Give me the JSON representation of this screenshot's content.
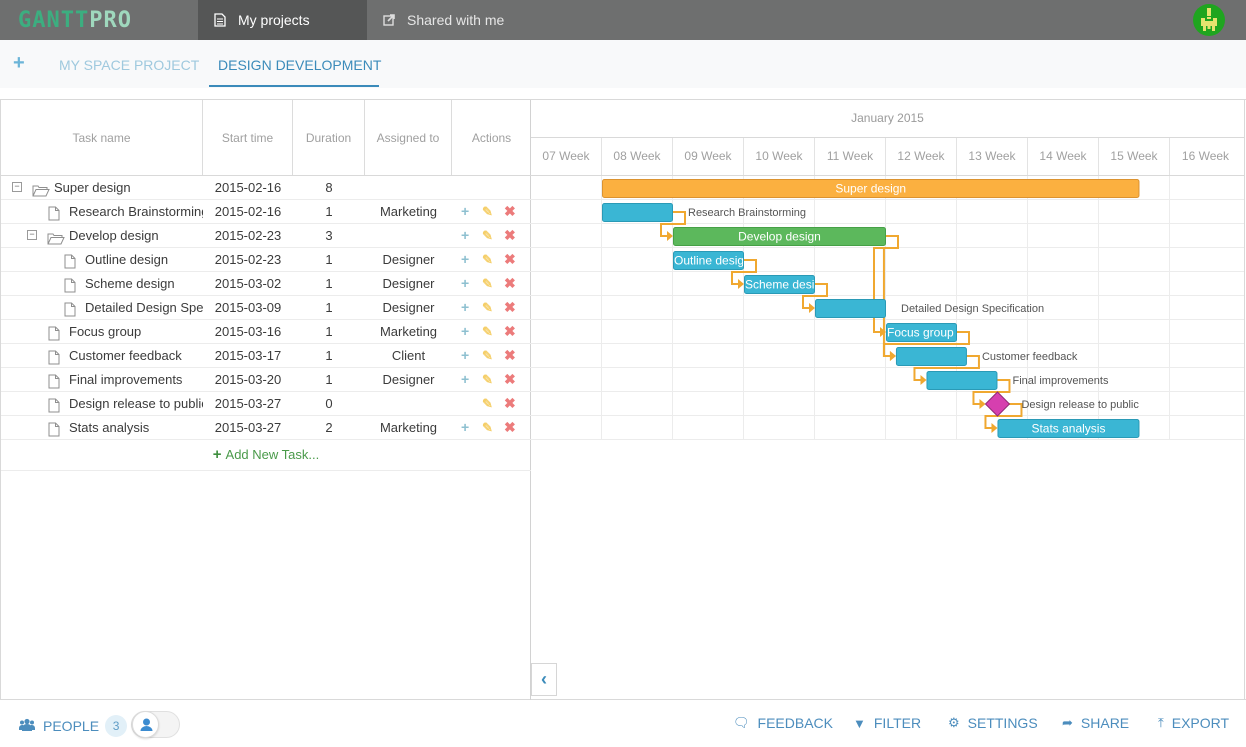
{
  "app": {
    "logo_part1": "GANTT",
    "logo_part2": "PRO",
    "nav_tabs": [
      {
        "label": "My projects",
        "icon": "document-icon",
        "active": true
      },
      {
        "label": "Shared with me",
        "icon": "share-icon",
        "active": false
      }
    ]
  },
  "project_tabs": {
    "add_icon": "+",
    "items": [
      {
        "label": "MY SPACE PROJECT",
        "active": false
      },
      {
        "label": "DESIGN DEVELOPMENT",
        "active": true
      }
    ]
  },
  "grid": {
    "columns": [
      "Task name",
      "Start time",
      "Duration",
      "Assigned to",
      "Actions"
    ],
    "rows": [
      {
        "name": "Super design",
        "start": "2015-02-16",
        "duration": "8",
        "assigned": "",
        "level": 0,
        "type": "folder",
        "collapsible": true,
        "actions": []
      },
      {
        "name": "Research Brainstorming",
        "start": "2015-02-16",
        "duration": "1",
        "assigned": "Marketing",
        "level": 1,
        "type": "file",
        "collapsible": false,
        "actions": [
          "add",
          "edit",
          "delete"
        ]
      },
      {
        "name": "Develop design",
        "start": "2015-02-23",
        "duration": "3",
        "assigned": "",
        "level": 1,
        "type": "folder",
        "collapsible": true,
        "actions": [
          "add",
          "edit",
          "delete"
        ]
      },
      {
        "name": "Outline design",
        "start": "2015-02-23",
        "duration": "1",
        "assigned": "Designer",
        "level": 2,
        "type": "file",
        "collapsible": false,
        "actions": [
          "add",
          "edit",
          "delete"
        ]
      },
      {
        "name": "Scheme design",
        "start": "2015-03-02",
        "duration": "1",
        "assigned": "Designer",
        "level": 2,
        "type": "file",
        "collapsible": false,
        "actions": [
          "add",
          "edit",
          "delete"
        ]
      },
      {
        "name": "Detailed Design Specification",
        "start": "2015-03-09",
        "duration": "1",
        "assigned": "Designer",
        "level": 2,
        "type": "file",
        "collapsible": false,
        "actions": [
          "add",
          "edit",
          "delete"
        ]
      },
      {
        "name": "Focus group",
        "start": "2015-03-16",
        "duration": "1",
        "assigned": "Marketing",
        "level": 1,
        "type": "file",
        "collapsible": false,
        "actions": [
          "add",
          "edit",
          "delete"
        ]
      },
      {
        "name": "Customer feedback",
        "start": "2015-03-17",
        "duration": "1",
        "assigned": "Client",
        "level": 1,
        "type": "file",
        "collapsible": false,
        "actions": [
          "add",
          "edit",
          "delete"
        ]
      },
      {
        "name": "Final improvements",
        "start": "2015-03-20",
        "duration": "1",
        "assigned": "Designer",
        "level": 1,
        "type": "file",
        "collapsible": false,
        "actions": [
          "add",
          "edit",
          "delete"
        ]
      },
      {
        "name": "Design release to public",
        "start": "2015-03-27",
        "duration": "0",
        "assigned": "",
        "level": 1,
        "type": "file",
        "collapsible": false,
        "actions": [
          "edit",
          "delete"
        ]
      },
      {
        "name": "Stats analysis",
        "start": "2015-03-27",
        "duration": "2",
        "assigned": "Marketing",
        "level": 1,
        "type": "file",
        "collapsible": false,
        "actions": [
          "add",
          "edit",
          "delete"
        ]
      }
    ],
    "add_task_label": "Add New Task..."
  },
  "gantt": {
    "month_label": "January 2015",
    "weeks": [
      "07 Week",
      "08 Week",
      "09 Week",
      "10 Week",
      "11 Week",
      "12 Week",
      "13 Week",
      "14 Week",
      "15 Week",
      "16 Week"
    ],
    "colors": {
      "summary": "#fbb040",
      "project": "#5cb85c",
      "task": "#3ab6d4",
      "milestone": "#d63faf",
      "link": "#f0a830"
    },
    "bars": [
      {
        "task": "Super design",
        "kind": "summary",
        "start_week": 1.0,
        "length_weeks": 7.57,
        "label_inside": "Super design",
        "label_outside": ""
      },
      {
        "task": "Research Brainstorming",
        "kind": "task",
        "start_week": 1.0,
        "length_weeks": 1.0,
        "label_inside": "",
        "label_outside": "Research Brainstorming"
      },
      {
        "task": "Develop design",
        "kind": "project",
        "start_week": 2.0,
        "length_weeks": 3.0,
        "label_inside": "Develop design",
        "label_outside": ""
      },
      {
        "task": "Outline design",
        "kind": "task",
        "start_week": 2.0,
        "length_weeks": 1.0,
        "label_inside": "Outline design",
        "label_outside": ""
      },
      {
        "task": "Scheme design",
        "kind": "task",
        "start_week": 3.0,
        "length_weeks": 1.0,
        "label_inside": "Scheme design",
        "label_outside": ""
      },
      {
        "task": "Detailed Design Specification",
        "kind": "task",
        "start_week": 4.0,
        "length_weeks": 1.0,
        "label_inside": "",
        "label_outside": "Detailed Design Specification"
      },
      {
        "task": "Focus group",
        "kind": "task",
        "start_week": 5.0,
        "length_weeks": 1.0,
        "label_inside": "Focus group",
        "label_outside": ""
      },
      {
        "task": "Customer feedback",
        "kind": "task",
        "start_week": 5.14,
        "length_weeks": 1.0,
        "label_inside": "",
        "label_outside": "Customer feedback"
      },
      {
        "task": "Final improvements",
        "kind": "task",
        "start_week": 5.57,
        "length_weeks": 1.0,
        "label_inside": "",
        "label_outside": "Final improvements"
      },
      {
        "task": "Design release to public",
        "kind": "milestone",
        "start_week": 6.57,
        "length_weeks": 0,
        "label_inside": "",
        "label_outside": "Design release to public"
      },
      {
        "task": "Stats analysis",
        "kind": "task",
        "start_week": 6.57,
        "length_weeks": 2.0,
        "label_inside": "Stats analysis",
        "label_outside": ""
      }
    ],
    "links": [
      {
        "from": 1,
        "to": 2
      },
      {
        "from": 3,
        "to": 4
      },
      {
        "from": 4,
        "to": 5
      },
      {
        "from": 2,
        "to": 6
      },
      {
        "from": 2,
        "to": 7
      },
      {
        "from": 6,
        "to": 7
      },
      {
        "from": 7,
        "to": 8
      },
      {
        "from": 8,
        "to": 9
      },
      {
        "from": 9,
        "to": 10
      }
    ],
    "collapse_icon": "‹"
  },
  "footer": {
    "people_label": "PEOPLE",
    "people_count": "3",
    "actions": [
      {
        "label": "FEEDBACK",
        "icon": "feedback-icon",
        "glyph": "🗨"
      },
      {
        "label": "FILTER",
        "icon": "filter-icon",
        "glyph": "▼"
      },
      {
        "label": "SETTINGS",
        "icon": "gear-icon",
        "glyph": "⚙"
      },
      {
        "label": "SHARE",
        "icon": "share-icon",
        "glyph": "➦"
      },
      {
        "label": "EXPORT",
        "icon": "export-icon",
        "glyph": "⤒"
      }
    ]
  }
}
